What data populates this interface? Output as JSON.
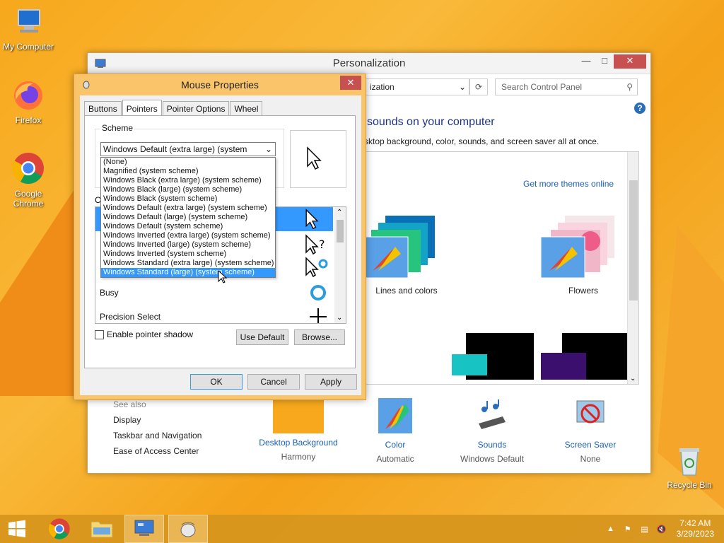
{
  "desktop": {
    "icons": [
      {
        "label": "My Computer"
      },
      {
        "label": "Firefox"
      },
      {
        "label": "Google Chrome"
      },
      {
        "label": "Recycle Bin"
      }
    ]
  },
  "personalization": {
    "title": "Personalization",
    "address": "ization",
    "search_placeholder": "Search Control Panel",
    "heading": "sounds on your computer",
    "subheading": "sktop background, color, sounds, and screen saver all at once.",
    "get_more": "Get more themes online",
    "themes": [
      {
        "label": "Lines and colors"
      },
      {
        "label": "Flowers"
      }
    ],
    "see_also": {
      "header": "See also",
      "links": [
        "Display",
        "Taskbar and Navigation",
        "Ease of Access Center"
      ]
    },
    "bottom": [
      {
        "label": "Desktop Background",
        "value": "Harmony"
      },
      {
        "label": "Color",
        "value": "Automatic"
      },
      {
        "label": "Sounds",
        "value": "Windows Default"
      },
      {
        "label": "Screen Saver",
        "value": "None"
      }
    ]
  },
  "mouse": {
    "title": "Mouse Properties",
    "tabs": [
      "Buttons",
      "Pointers",
      "Pointer Options",
      "Wheel"
    ],
    "scheme_label": "Scheme",
    "scheme_value": "Windows Default (extra large) (system scheme)",
    "options": [
      "(None)",
      "Magnified (system scheme)",
      "Windows Black (extra large) (system scheme)",
      "Windows Black (large) (system scheme)",
      "Windows Black (system scheme)",
      "Windows Default (extra large) (system scheme)",
      "Windows Default (large) (system scheme)",
      "Windows Default (system scheme)",
      "Windows Inverted (extra large) (system scheme)",
      "Windows Inverted (large) (system scheme)",
      "Windows Inverted (system scheme)",
      "Windows Standard (extra large) (system scheme)",
      "Windows Standard (large) (system scheme)"
    ],
    "customize_label": "C",
    "list_rows": [
      "Busy",
      "Precision Select"
    ],
    "shadow_label": "Enable pointer shadow",
    "use_default": "Use Default",
    "browse": "Browse...",
    "ok": "OK",
    "cancel": "Cancel",
    "apply": "Apply"
  },
  "taskbar": {
    "time": "7:42 AM",
    "date": "3/29/2023"
  }
}
